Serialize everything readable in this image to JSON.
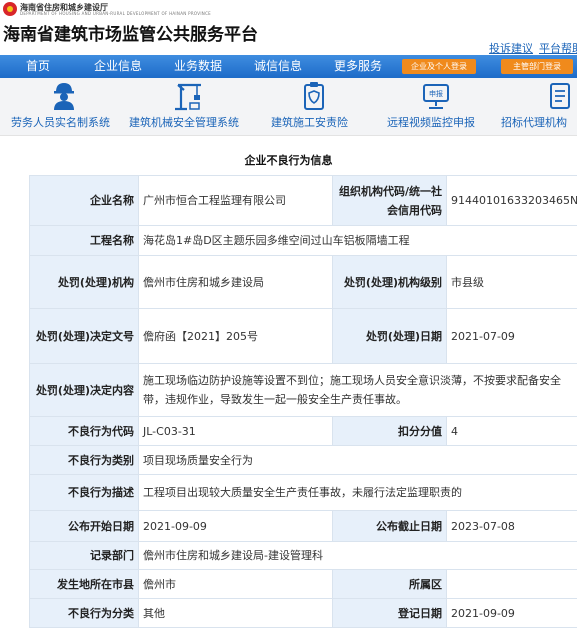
{
  "header": {
    "dept_name": "海南省住房和城乡建设厅",
    "dept_sub": "DEPARTMENT OF HOUSING AND URBAN-RURAL DEVELOPMENT OF HAINAN PROVINCE",
    "site_title": "海南省建筑市场监管公共服务平台",
    "links": [
      "投诉建议",
      "平台帮助"
    ]
  },
  "nav": {
    "items": [
      "首页",
      "企业信息",
      "业务数据",
      "诚信信息",
      "更多服务"
    ],
    "buttons": [
      "企业及个人登录",
      "主管部门登录"
    ]
  },
  "quick_links": [
    {
      "label": "劳务人员实名制系统",
      "icon": "worker-icon"
    },
    {
      "label": "建筑机械安全管理系统",
      "icon": "crane-icon"
    },
    {
      "label": "建筑施工安责险",
      "icon": "insurance-icon"
    },
    {
      "label": "远程视频监控申报",
      "icon": "video-monitor-icon"
    },
    {
      "label": "招标代理机构",
      "icon": "document-icon"
    }
  ],
  "section_title": "企业不良行为信息",
  "record": {
    "company_label": "企业名称",
    "company": "广州市恒合工程监理有限公司",
    "org_code_label": "组织机构代码/统一社会信用代码",
    "org_code": "91440101633203465N",
    "project_label": "工程名称",
    "project": "海花岛1#岛D区主题乐园多维空间过山车铝板隔墙工程",
    "agency_label": "处罚(处理)机构",
    "agency": "儋州市住房和城乡建设局",
    "agency_level_label": "处罚(处理)机构级别",
    "agency_level": "市县级",
    "decision_no_label": "处罚(处理)决定文号",
    "decision_no": "儋府函【2021】205号",
    "decision_date_label": "处罚(处理)日期",
    "decision_date": "2021-07-09",
    "content_label": "处罚(处理)决定内容",
    "content": "施工现场临边防护设施等设置不到位；施工现场人员安全意识淡薄，不按要求配备安全带，违规作业，导致发生一起一般安全生产责任事故。",
    "code_label": "不良行为代码",
    "code": "JL-C03-31",
    "score_label": "扣分分值",
    "score": "4",
    "category_label": "不良行为类别",
    "category": "项目现场质量安全行为",
    "desc_label": "不良行为描述",
    "desc": "工程项目出现较大质量安全生产责任事故，未履行法定监理职责的",
    "start_label": "公布开始日期",
    "start": "2021-09-09",
    "end_label": "公布截止日期",
    "end": "2023-07-08",
    "dept_label": "记录部门",
    "dept": "儋州市住房和城乡建设局-建设管理科",
    "city_label": "发生地所在市县",
    "city": "儋州市",
    "district_label": "所属区",
    "district": "",
    "class_label": "不良行为分类",
    "class": "其他",
    "reg_date_label": "登记日期",
    "reg_date": "2021-09-09"
  }
}
